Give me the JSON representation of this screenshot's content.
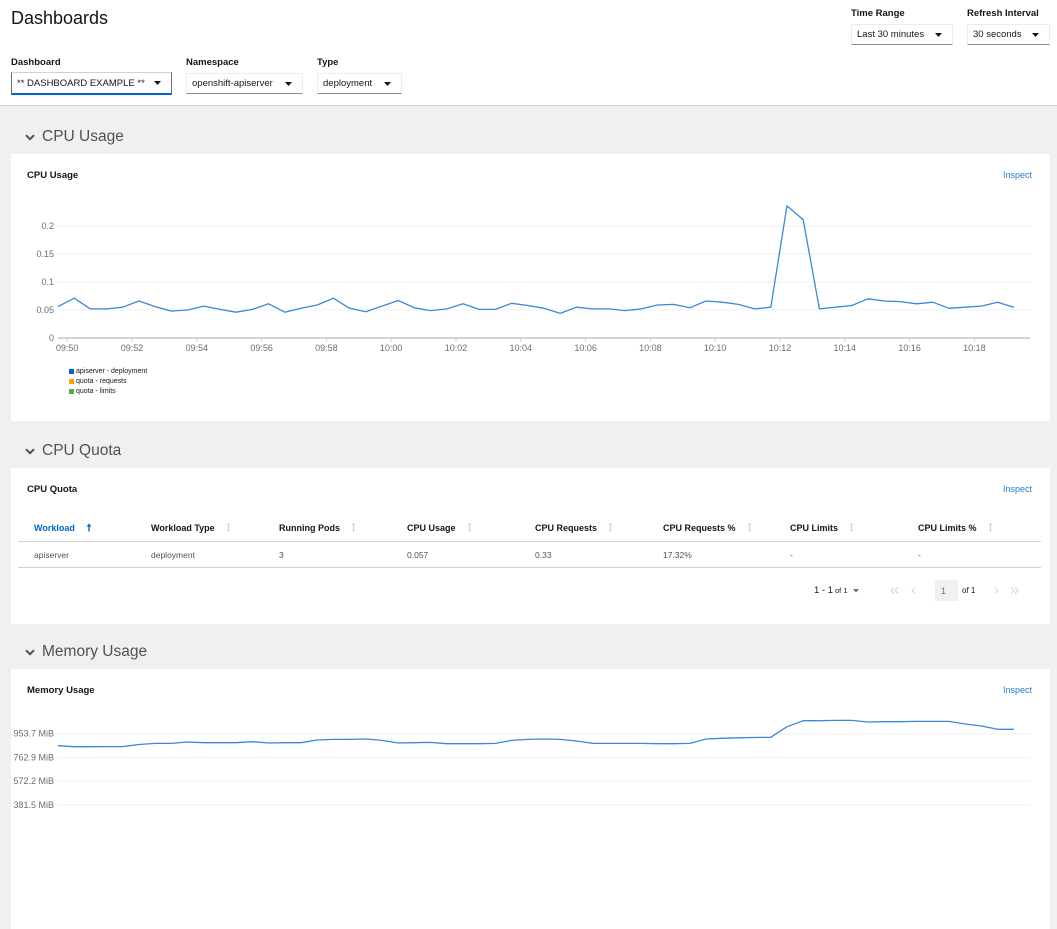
{
  "header": {
    "title": "Dashboards",
    "time_range": {
      "label": "Time Range",
      "value": "Last 30 minutes"
    },
    "refresh_interval": {
      "label": "Refresh Interval",
      "value": "30 seconds"
    },
    "filters": [
      {
        "label": "Dashboard",
        "value": "** DASHBOARD EXAMPLE **"
      },
      {
        "label": "Namespace",
        "value": "openshift-apiserver"
      },
      {
        "label": "Type",
        "value": "deployment"
      }
    ]
  },
  "sections": [
    {
      "heading": "CPU Usage",
      "card_title": "CPU Usage",
      "inspect_label": "Inspect",
      "toggle_icon": "chevron-down"
    },
    {
      "heading": "CPU Quota",
      "card_title": "CPU Quota",
      "inspect_label": "Inspect",
      "toggle_icon": "chevron-down"
    },
    {
      "heading": "Memory Usage",
      "card_title": "Memory Usage",
      "inspect_label": "Inspect",
      "toggle_icon": "chevron-down"
    }
  ],
  "cpu_quota_table": {
    "columns": [
      "Workload",
      "Workload Type",
      "Running Pods",
      "CPU Usage",
      "CPU Requests",
      "CPU Requests %",
      "CPU Limits",
      "CPU Limits %"
    ],
    "sort": {
      "column": "Workload",
      "direction": "ascending"
    },
    "rows": [
      [
        "apiserver",
        "deployment",
        "3",
        "0.057",
        "0.33",
        "17.32%",
        "-",
        "-"
      ]
    ],
    "pagination": {
      "range_label": "1 - 1",
      "of_total_label": "of 1",
      "page_value": "1",
      "page_of_label": "of 1"
    }
  },
  "chart_data": [
    {
      "type": "line",
      "title": "CPU Usage",
      "xlabel": "",
      "ylabel": "",
      "x_start": "09:49:43",
      "x_step_seconds": 30,
      "xlim": [
        "09:49:43",
        "10:19:43"
      ],
      "ylim": [
        0,
        0.25
      ],
      "y_ticks": [
        0,
        0.05,
        0.1,
        0.15,
        0.2
      ],
      "y_tick_labels": [
        "0",
        "0.05",
        "0.1",
        "0.15",
        "0.2"
      ],
      "x_tick_labels": [
        "09:50",
        "09:52",
        "09:54",
        "09:56",
        "09:58",
        "10:00",
        "10:02",
        "10:04",
        "10:06",
        "10:08",
        "10:10",
        "10:12",
        "10:14",
        "10:16",
        "10:18"
      ],
      "grid": true,
      "legend_position": "bottom-left",
      "series": [
        {
          "name": "apiserver - deployment",
          "color": "#0066cc",
          "values": [
            0.056,
            0.071,
            0.052,
            0.052,
            0.055,
            0.066,
            0.056,
            0.048,
            0.05,
            0.057,
            0.051,
            0.046,
            0.051,
            0.061,
            0.046,
            0.053,
            0.059,
            0.071,
            0.053,
            0.047,
            0.057,
            0.067,
            0.054,
            0.049,
            0.052,
            0.061,
            0.051,
            0.051,
            0.062,
            0.058,
            0.053,
            0.044,
            0.055,
            0.052,
            0.052,
            0.049,
            0.052,
            0.059,
            0.06,
            0.054,
            0.066,
            0.064,
            0.06,
            0.052,
            0.055,
            0.236,
            0.211,
            0.052,
            0.055,
            0.058,
            0.07,
            0.066,
            0.065,
            0.061,
            0.064,
            0.053,
            0.055,
            0.057,
            0.064,
            0.055
          ]
        },
        {
          "name": "quota - requests",
          "color": "#f0ab00",
          "values": []
        },
        {
          "name": "quota - limits",
          "color": "#4cb140",
          "values": []
        }
      ]
    },
    {
      "type": "line",
      "title": "Memory Usage",
      "xlabel": "",
      "ylabel": "",
      "unit": "MiB",
      "x_start": "09:49:43",
      "x_step_seconds": 30,
      "xlim": [
        "09:49:43",
        "10:19:43"
      ],
      "ylim": [
        0,
        1144.4
      ],
      "y_ticks": [
        381.5,
        572.2,
        762.9,
        953.7
      ],
      "y_tick_labels": [
        "381.5 MiB",
        "572.2 MiB",
        "762.9 MiB",
        "953.7 MiB"
      ],
      "grid": true,
      "series": [
        {
          "color": "#0066cc",
          "values": [
            857,
            849,
            849,
            850,
            850,
            867,
            876,
            876,
            887,
            881,
            881,
            881,
            889,
            879,
            881,
            881,
            903,
            908,
            908,
            911,
            900,
            879,
            881,
            884,
            873,
            873,
            873,
            876,
            900,
            908,
            911,
            908,
            895,
            876,
            876,
            876,
            876,
            873,
            873,
            876,
            911,
            917,
            921,
            923,
            925,
            1010,
            1058,
            1058,
            1061,
            1061,
            1048,
            1050,
            1050,
            1053,
            1053,
            1053,
            1032,
            1016,
            989,
            989
          ]
        }
      ]
    }
  ]
}
